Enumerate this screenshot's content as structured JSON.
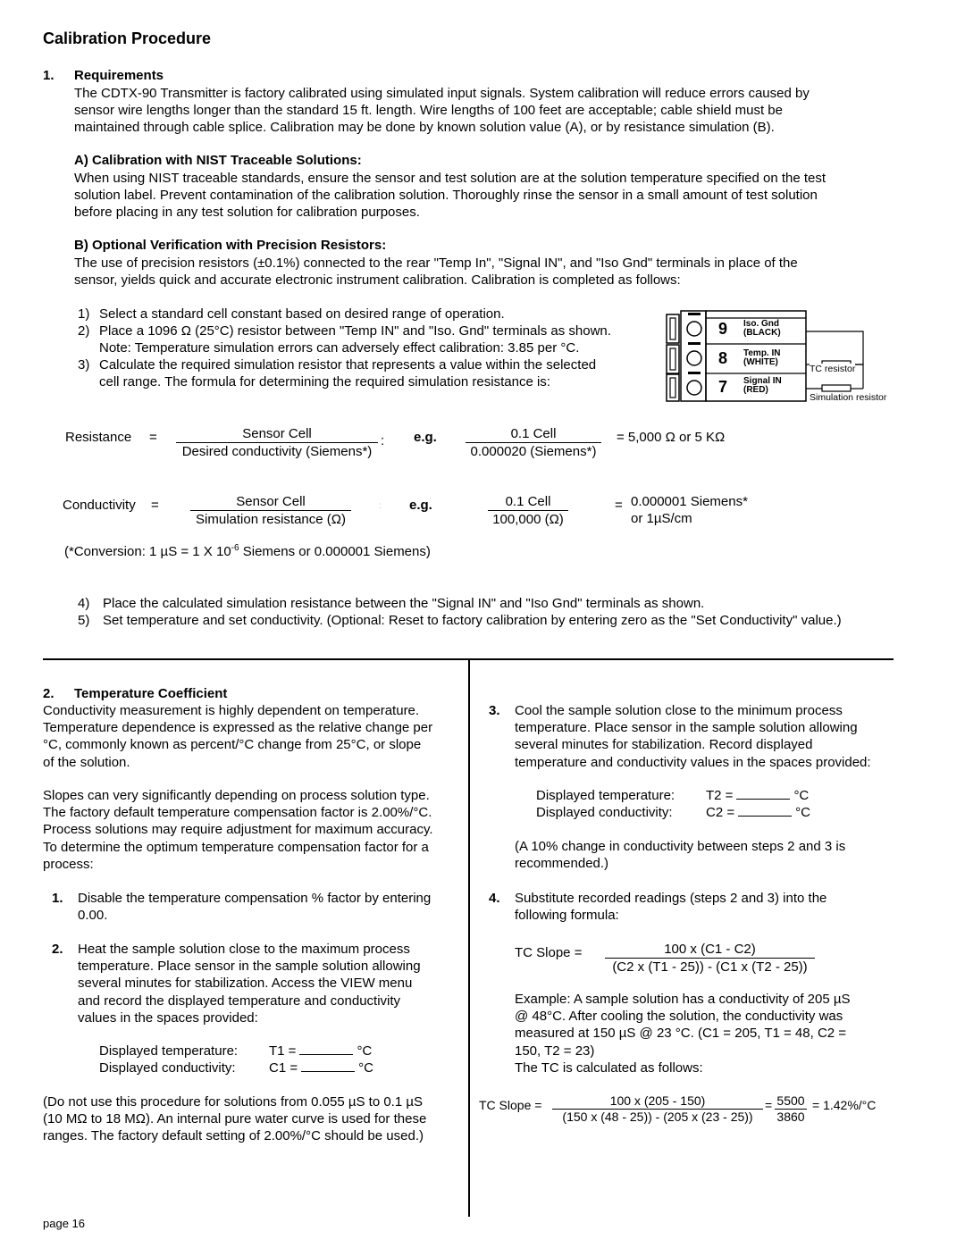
{
  "title": "Calibration Procedure",
  "section1": {
    "number": "1.",
    "heading": "Requirements",
    "intro": [
      "The CDTX-90 Transmitter is factory calibrated using simulated input signals.  System calibration will reduce errors caused by",
      "sensor wire lengths longer than the standard 15 ft. length.  Wire lengths of 100 feet are acceptable;  cable shield must be",
      "maintained through cable splice.  Calibration may be done by known solution value (A), or by resistance simulation (B)."
    ],
    "subA": {
      "heading": "A)  Calibration with NIST Traceable Solutions:",
      "lines": [
        "When using NIST traceable standards, ensure the sensor and test solution are at the solution temperature specified on the test",
        "solution label.  Prevent contamination of the calibration solution.  Thoroughly rinse the sensor in a small amount of test solution",
        "before placing in any test solution for calibration purposes."
      ]
    },
    "subB": {
      "heading": "B)  Optional Verification with Precision Resistors:",
      "lines": [
        "The use of precision resistors (±0.1%) connected to the rear \"Temp In\", \"Signal IN\", and \"Iso Gnd\" terminals in place of the",
        "sensor, yields quick and accurate electronic instrument calibration.  Calibration is completed as follows:"
      ]
    },
    "steps": [
      {
        "n": "1)",
        "lines": [
          "Select a standard cell constant based on desired range of operation."
        ]
      },
      {
        "n": "2)",
        "lines": [
          "Place a 1096 Ω (25°C) resistor between \"Temp IN\" and \"Iso. Gnd\" terminals as shown.",
          "Note: Temperature simulation errors can adversely effect calibration:  3.85 per °C."
        ]
      },
      {
        "n": "3)",
        "lines": [
          "Calculate the required simulation resistor that represents a value within the selected",
          "cell range.  The formula for determining the required simulation resistance is:"
        ]
      }
    ],
    "diagram": {
      "terminals": [
        {
          "number": "9",
          "name": "Iso. Gnd",
          "color": "(BLACK)"
        },
        {
          "number": "8",
          "name": "Temp. IN",
          "color": "(WHITE)"
        },
        {
          "number": "7",
          "name": "Signal IN",
          "color": "(RED)"
        }
      ],
      "tc_resistor_label": "TC resistor",
      "sim_resistor_label": "Simulation resistor"
    },
    "formula_resistance": {
      "label": "Resistance",
      "eq": "=",
      "numerator": "Sensor Cell",
      "denominator": "Desired conductivity (Siemens*)",
      "colon": ":",
      "eg": "e.g.",
      "ex_numerator": "0.1 Cell",
      "ex_denominator": "0.000020 (Siemens*)",
      "result": "=  5,000 Ω or 5 KΩ"
    },
    "formula_conductivity": {
      "label": "Conductivity",
      "eq": "=",
      "numerator": "Sensor Cell",
      "denominator": "Simulation resistance (Ω)",
      "colon": ":",
      "eg": "e.g.",
      "ex_numerator": "0.1 Cell",
      "ex_denominator": "100,000 (Ω)",
      "result_eq": "=",
      "result_line1": "0.000001 Siemens*",
      "result_line2": "or 1µS/cm"
    },
    "conversion": {
      "pre": "(*Conversion:  1 µS  =  1 X 10",
      "sup": "-6",
      "post": " Siemens or 0.000001 Siemens)"
    },
    "steps_after": [
      {
        "n": "4)",
        "text": "Place the calculated simulation resistance between the \"Signal IN\" and \"Iso Gnd\" terminals as shown."
      },
      {
        "n": "5)",
        "text": "Set temperature and set conductivity.  (Optional: Reset to factory calibration by entering zero as the \"Set Conductivity\" value.)"
      }
    ]
  },
  "section2": {
    "number": "2.",
    "heading": "Temperature Coefficient",
    "para1": [
      "Conductivity measurement is highly dependent on temperature.",
      "Temperature dependence is expressed as the relative change per",
      "°C, commonly known as percent/°C change from 25°C, or slope",
      "of the solution."
    ],
    "para2": [
      "Slopes can very significantly depending on process solution type.",
      "The factory default temperature compensation factor is 2.00%/°C.",
      "Process solutions may require adjustment for maximum accuracy.",
      "To determine the optimum temperature compensation factor for a",
      "process:"
    ],
    "step1": {
      "n": "1.",
      "lines": [
        "Disable the temperature compensation % factor by entering",
        "0.00."
      ]
    },
    "step2": {
      "n": "2.",
      "lines": [
        "Heat the sample solution close to the maximum process",
        "temperature.  Place sensor in the sample solution allowing",
        "several minutes for stabilization.  Access the VIEW menu",
        "and record the displayed temperature and conductivity",
        "values in the spaces provided:"
      ]
    },
    "readings1": {
      "temp_label": "Displayed temperature:",
      "temp_var": "T1 =",
      "temp_unit": "°C",
      "cond_label": "Displayed conductivity:",
      "cond_var": "C1 =",
      "cond_unit": "°C"
    },
    "note": [
      "(Do not use this procedure for solutions from 0.055 µS to 0.1 µS",
      "(10 MΩ to 18 MΩ).  An internal pure water curve is used for these",
      "ranges.  The factory default setting of 2.00%/°C should be used.)"
    ],
    "step3": {
      "n": "3.",
      "lines": [
        "Cool the sample solution close to the minimum process",
        "temperature.  Place sensor in the sample solution allowing",
        "several minutes for stabilization.  Record displayed",
        "temperature and conductivity values in the spaces provided:"
      ]
    },
    "readings2": {
      "temp_label": "Displayed temperature:",
      "temp_var": "T2 =",
      "temp_unit": "°C",
      "cond_label": "Displayed conductivity:",
      "cond_var": "C2 =",
      "cond_unit": "°C"
    },
    "step3_note": [
      "(A 10% change in conductivity between steps 2 and 3 is",
      "recommended.)"
    ],
    "step4": {
      "n": "4.",
      "lines": [
        "Substitute recorded readings (steps 2 and 3) into the",
        "following formula:"
      ]
    },
    "tc_formula": {
      "label": "TC Slope =",
      "numerator": "100 x (C1 - C2)",
      "denominator": "(C2 x (T1 - 25)) - (C1 x (T2 - 25))"
    },
    "example": [
      "Example:  A sample solution has a conductivity of 205 µS",
      "@ 48°C.  After cooling the solution, the conductivity was",
      "measured at 150 µS @ 23 °C.  (C1 = 205, T1 = 48, C2 =",
      "150, T2 = 23)",
      "The TC is calculated as follows:"
    ],
    "tc_example": {
      "label": "TC Slope =",
      "numerator": "100 x (205 - 150)",
      "denominator": "(150 x (48 - 25)) - (205 x (23 - 25))",
      "eq": "=",
      "r_numerator": "5500",
      "r_denominator": "3860",
      "result": "= 1.42%/°C"
    }
  },
  "footer": {
    "page": "page 16"
  }
}
